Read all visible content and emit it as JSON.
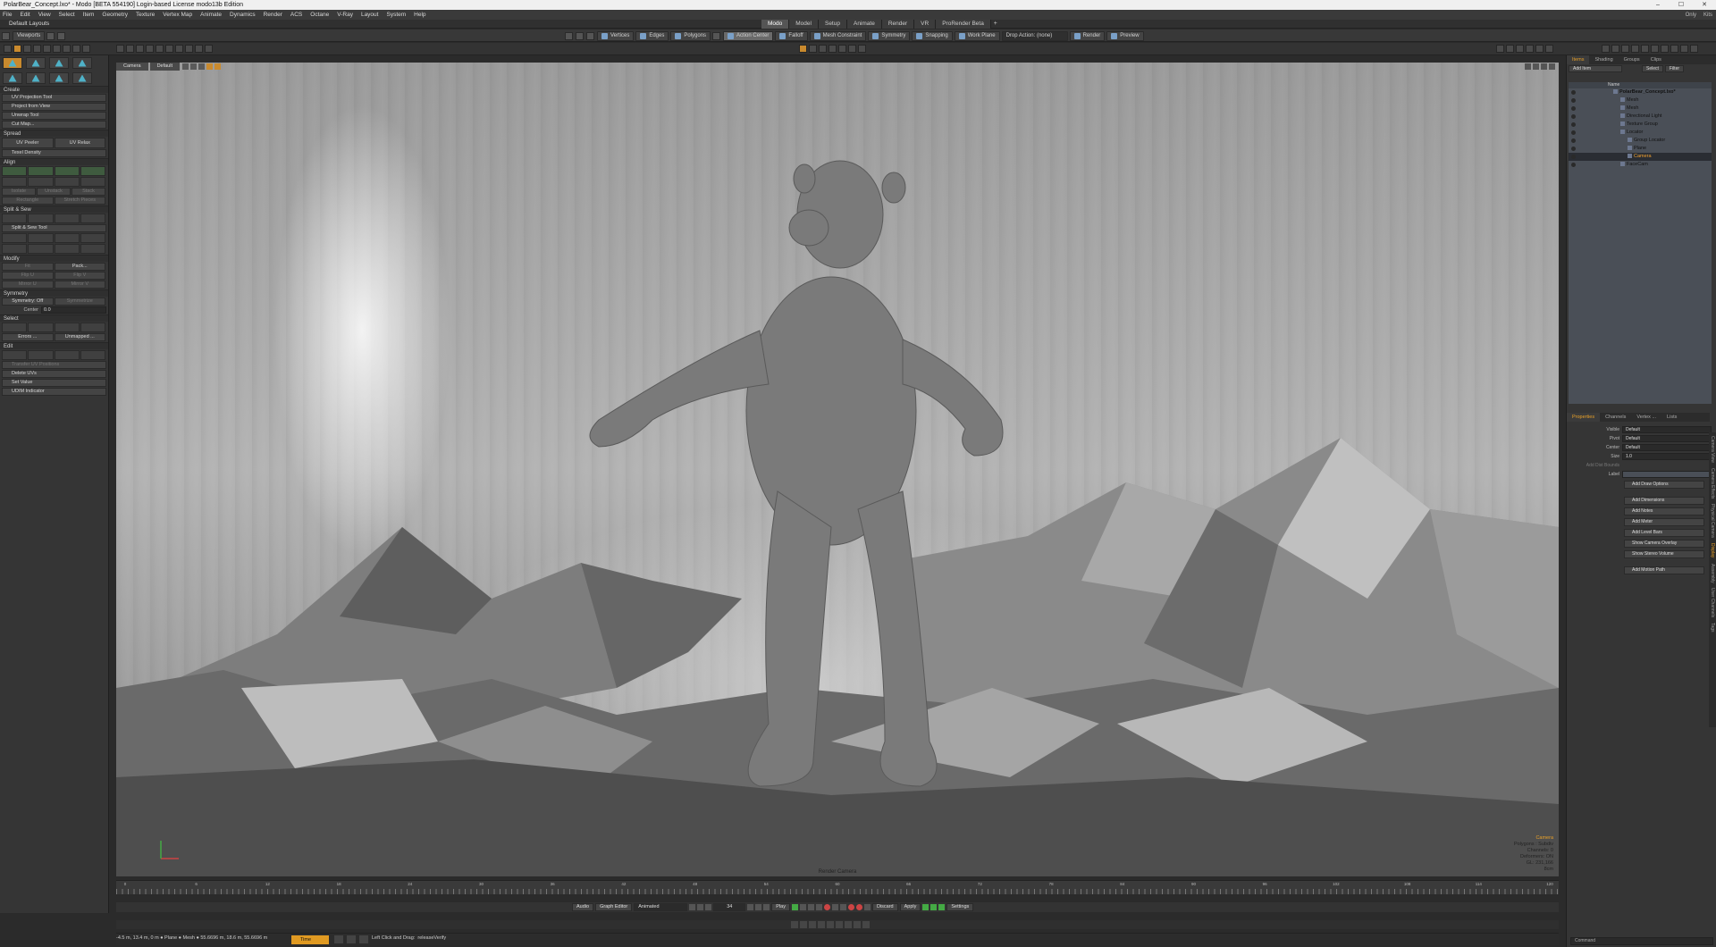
{
  "window": {
    "title": "PolarBear_Concept.lxo* - Modo [BETA 554190] Login-based License  modo13b Edition",
    "controls": [
      "–",
      "☐",
      "✕"
    ]
  },
  "menu": {
    "items": [
      "File",
      "Edit",
      "View",
      "Select",
      "Item",
      "Geometry",
      "Texture",
      "Vertex Map",
      "Animate",
      "Dynamics",
      "Render",
      "ACS",
      "Octane",
      "V-Ray",
      "Layout",
      "System",
      "Help"
    ],
    "right": [
      "Only",
      "Kits"
    ]
  },
  "layouts": {
    "label": "Default Layouts",
    "tabs": [
      "Modo",
      "Model",
      "Setup",
      "Animate",
      "Render",
      "VR",
      "ProRender Beta"
    ],
    "active_tab": "Modo",
    "add": "+"
  },
  "toolbar": {
    "viewports_label": "Viewports",
    "components": [
      "Vertices",
      "Edges",
      "Polygons"
    ],
    "tools": [
      "Action Center",
      "Falloff",
      "Mesh Constraint",
      "Symmetry",
      "Snapping",
      "Work Plane"
    ],
    "drop_action": "Drop Action: (none)",
    "render": "Render",
    "preview": "Preview"
  },
  "left_panel": {
    "create_header": "Create",
    "create_items": [
      "UV Projection Tool",
      "Project from View",
      "Unwrap Tool",
      "Cut Map..."
    ],
    "spread_header": "Spread",
    "spread_pair": [
      "UV Peeler",
      "UV Relax"
    ],
    "texel_density": "Texel Density",
    "align_header": "Align",
    "align_row": [
      "Isolate",
      "Unstack",
      "Stack"
    ],
    "align_row2": [
      "Rectangle",
      "Stretch Pieces"
    ],
    "split_header": "Split & Sew",
    "split_tool": "Split & Sew Tool",
    "modify_header": "Modify",
    "modify_row1": [
      "Fit",
      "Pack..."
    ],
    "modify_row2": [
      "Flip U",
      "Flip V"
    ],
    "modify_row3": [
      "Mirror U",
      "Mirror V"
    ],
    "symmetry_header": "Symmetry",
    "symmetry_value": "Symmetry: Off",
    "symmetry_right": "Symmetrize",
    "center_label": "Center",
    "center_value": "0.0",
    "select_header": "Select",
    "select_row": [
      "Errors ...",
      "Unmapped ..."
    ],
    "edit_header": "Edit",
    "edit_items": [
      "Transfer UV Positions",
      "Delete UVs",
      "Set Value",
      "UDIM Indicator"
    ]
  },
  "viewport": {
    "tabs": [
      "Camera",
      "Default"
    ],
    "label": "Render Camera",
    "stats": {
      "camera": "Camera",
      "lines": [
        "Polygons : Subdiv",
        "Channels: 0",
        "Deformers: ON",
        "GL: 231,166",
        "8cm"
      ]
    }
  },
  "timeline": {
    "ticks": [
      "0",
      "6",
      "12",
      "18",
      "24",
      "30",
      "36",
      "42",
      "48",
      "54",
      "60",
      "66",
      "72",
      "78",
      "84",
      "90",
      "96",
      "102",
      "108",
      "114",
      "120"
    ]
  },
  "playbar": {
    "audio": "Audio",
    "graph_editor": "Graph Editor",
    "animated": "Animated",
    "frame": "34",
    "play": "Play",
    "discard": "Discard",
    "apply": "Apply",
    "settings": "Settings"
  },
  "status": {
    "coords": "-4.5 m, 13.4 m, 0 m ● Plane ● Mesh ● 55.6696 m, 18.6 m, 55.6696 m",
    "time": "Time",
    "hint_key": "Left Click and Drag:",
    "hint_val": "releaseVerify"
  },
  "right_panel": {
    "tabs": [
      "Items",
      "Shading",
      "Groups",
      "Clips"
    ],
    "active_tab": "Items",
    "add_item": "Add Item",
    "select": "Select",
    "filter": "Filter",
    "col_name": "Name",
    "tree": [
      {
        "label": "PolarBear_Concept.lxo*",
        "indent": 50,
        "bold": true
      },
      {
        "label": "Mesh",
        "indent": 58
      },
      {
        "label": "Mesh",
        "indent": 58
      },
      {
        "label": "Directional Light",
        "indent": 58
      },
      {
        "label": "Texture Group",
        "indent": 58
      },
      {
        "label": "Locator",
        "indent": 58
      },
      {
        "label": "Group Locator",
        "indent": 66
      },
      {
        "label": "Plane",
        "indent": 66
      },
      {
        "label": "Camera",
        "indent": 66,
        "selected": true
      },
      {
        "label": "FaceCam",
        "indent": 58
      }
    ],
    "prop_tabs": [
      "Properties",
      "Channels",
      "Vertex ...",
      "Lists"
    ],
    "props": [
      {
        "k": "Visible",
        "v": "Default"
      },
      {
        "k": "Pivot",
        "v": "Default"
      },
      {
        "k": "Center",
        "v": "Default"
      },
      {
        "k": "Size",
        "v": "1.0"
      }
    ],
    "prop_dim": "Add Dist Bounds",
    "prop_label": "Label",
    "prop_buttons": [
      "Add Draw Options",
      "Add Dimensions",
      "Add Notes",
      "Add Meter",
      "Add Level Bars",
      "Show Camera Overlay",
      "Show Stereo Volume",
      "Add Motion Path"
    ],
    "side_tabs": [
      "Camera View",
      "Camera Effects",
      "Physical Camera",
      "Display",
      "Assembly",
      "User Channels",
      "Tags"
    ],
    "side_active": "Display",
    "command": "Command"
  }
}
